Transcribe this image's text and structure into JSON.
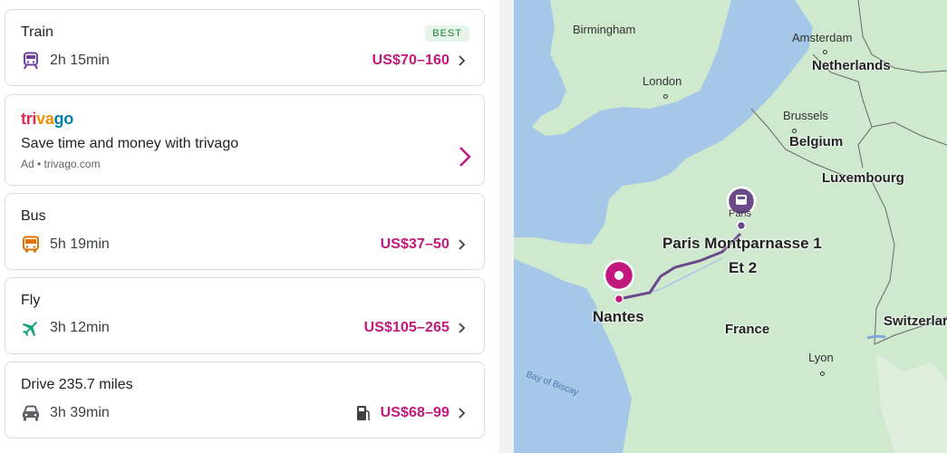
{
  "options": [
    {
      "title": "Train",
      "badge": "BEST",
      "icon": "train-icon",
      "duration": "2h 15min",
      "price": "US$70–160"
    },
    {
      "title": "Bus",
      "icon": "bus-icon",
      "duration": "5h 19min",
      "price": "US$37–50"
    },
    {
      "title": "Fly",
      "icon": "plane-icon",
      "duration": "3h 12min",
      "price": "US$105–265"
    },
    {
      "title": "Drive 235.7 miles",
      "icon": "car-icon",
      "duration": "3h 39min",
      "price": "US$68–99",
      "extra_icon": "fuel-icon"
    }
  ],
  "ad": {
    "logo": "trivago",
    "title": "Save time and money with trivago",
    "sub": "Ad • trivago.com"
  },
  "map": {
    "labels": {
      "birmingham": "Birmingham",
      "amsterdam": "Amsterdam",
      "netherlands": "Netherlands",
      "london": "London",
      "brussels": "Brussels",
      "belgium": "Belgium",
      "luxembourg": "Luxembourg",
      "paris": "Paris",
      "paris_station_1": "Paris Montparnasse 1",
      "paris_station_2": "Et 2",
      "nantes": "Nantes",
      "france": "France",
      "switzerland": "Switzerlar",
      "lyon": "Lyon",
      "bay_of_biscay": "Bay of Biscay"
    }
  },
  "colors": {
    "price": "#c2187d",
    "route": "#6b4a8a",
    "land": "#cfe9cf",
    "water": "#a6c8e8"
  }
}
